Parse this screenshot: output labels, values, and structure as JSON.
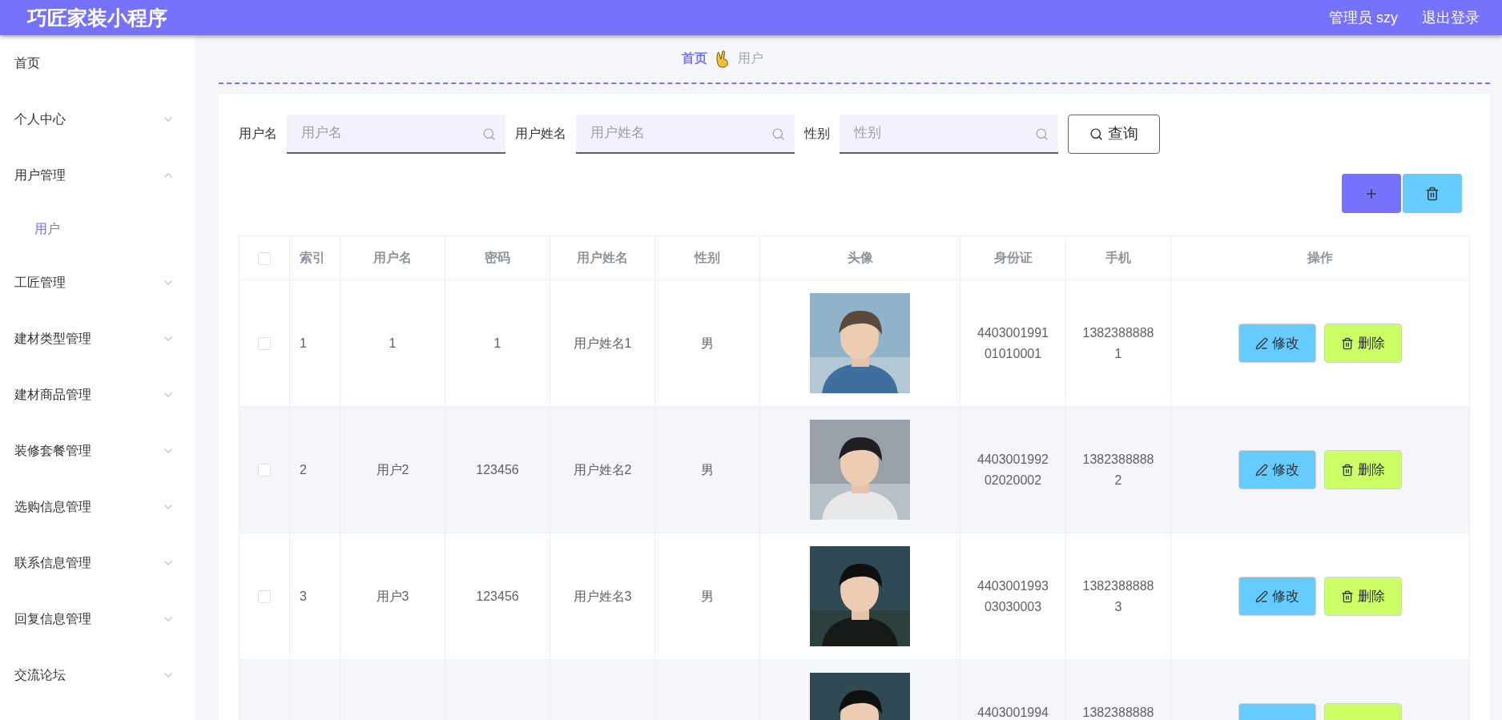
{
  "header": {
    "title": "巧匠家装小程序",
    "user": "管理员 szy",
    "logout": "退出登录"
  },
  "sidebar": {
    "items": [
      {
        "label": "首页",
        "expandable": false
      },
      {
        "label": "个人中心",
        "expandable": true,
        "expanded": false
      },
      {
        "label": "用户管理",
        "expandable": true,
        "expanded": true,
        "children": [
          {
            "label": "用户",
            "selected": true
          }
        ]
      },
      {
        "label": "工匠管理",
        "expandable": true,
        "expanded": false
      },
      {
        "label": "建材类型管理",
        "expandable": true,
        "expanded": false
      },
      {
        "label": "建材商品管理",
        "expandable": true,
        "expanded": false
      },
      {
        "label": "装修套餐管理",
        "expandable": true,
        "expanded": false
      },
      {
        "label": "选购信息管理",
        "expandable": true,
        "expanded": false
      },
      {
        "label": "联系信息管理",
        "expandable": true,
        "expanded": false
      },
      {
        "label": "回复信息管理",
        "expandable": true,
        "expanded": false
      },
      {
        "label": "交流论坛",
        "expandable": true,
        "expanded": false
      }
    ]
  },
  "breadcrumb": [
    {
      "label": "首页",
      "selected": true
    },
    {
      "label": "用户",
      "selected": false
    }
  ],
  "search": {
    "fields": [
      {
        "label": "用户名",
        "placeholder": "用户名"
      },
      {
        "label": "用户姓名",
        "placeholder": "用户姓名"
      },
      {
        "label": "性别",
        "placeholder": "性别"
      }
    ],
    "button": "查询"
  },
  "table": {
    "select_all_checked": false,
    "columns": [
      "索引",
      "用户名",
      "密码",
      "用户姓名",
      "性别",
      "头像",
      "身份证",
      "手机",
      "操作"
    ],
    "rows": [
      {
        "checked": false,
        "cells": [
          "1",
          "1",
          "1",
          "用户姓名1",
          "男"
        ],
        "avatar": {
          "kind": "picture"
        },
        "id_card": "440300199101010001",
        "phone": "13823888881",
        "actions": [
          {
            "kind": "edit",
            "label": "修改"
          },
          {
            "kind": "delete",
            "label": "删除"
          }
        ]
      },
      {
        "checked": false,
        "cells": [
          "2",
          "用户2",
          "123456",
          "用户姓名2",
          "男"
        ],
        "avatar": {
          "kind": "picture"
        },
        "id_card": "440300199202020002",
        "phone": "13823888882",
        "actions": [
          {
            "kind": "edit",
            "label": "修改"
          },
          {
            "kind": "delete",
            "label": "删除"
          }
        ]
      },
      {
        "checked": false,
        "cells": [
          "3",
          "用户3",
          "123456",
          "用户姓名3",
          "男"
        ],
        "avatar": {
          "kind": "picture"
        },
        "id_card": "440300199303030003",
        "phone": "13823888883",
        "actions": [
          {
            "kind": "edit",
            "label": "修改"
          },
          {
            "kind": "delete",
            "label": "删除"
          }
        ]
      },
      {
        "avatar": {
          "kind": "picture"
        },
        "id_card": "4403001994",
        "phone": "1382388888",
        "actions": [
          {
            "kind": "edit"
          },
          {
            "kind": "delete"
          }
        ]
      }
    ]
  }
}
